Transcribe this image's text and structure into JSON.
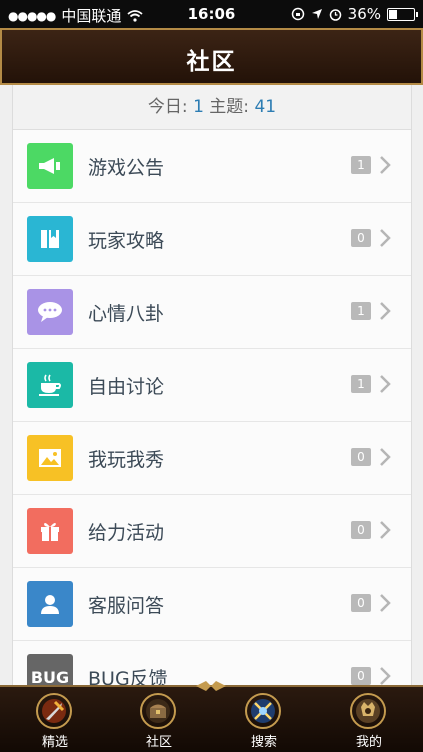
{
  "status_bar": {
    "carrier": "中国联通",
    "time": "16:06",
    "battery": "36%",
    "battery_level": 0.36
  },
  "header": {
    "title": "社区"
  },
  "stats": {
    "today_label": "今日:",
    "today_value": "1",
    "topics_label": "主题:",
    "topics_value": "41"
  },
  "forums": [
    {
      "label": "游戏公告",
      "count": "1",
      "icon": "megaphone-icon",
      "color": "#4cd964"
    },
    {
      "label": "玩家攻略",
      "count": "0",
      "icon": "book-icon",
      "color": "#2ab6d3"
    },
    {
      "label": "心情八卦",
      "count": "1",
      "icon": "chat-bubble-icon",
      "color": "#a993e6"
    },
    {
      "label": "自由讨论",
      "count": "1",
      "icon": "coffee-cup-icon",
      "color": "#1bb9a6"
    },
    {
      "label": "我玩我秀",
      "count": "0",
      "icon": "picture-icon",
      "color": "#f7c125"
    },
    {
      "label": "给力活动",
      "count": "0",
      "icon": "gift-icon",
      "color": "#f26d5f"
    },
    {
      "label": "客服问答",
      "count": "0",
      "icon": "user-icon",
      "color": "#3a87c9"
    },
    {
      "label": "BUG反馈",
      "count": "0",
      "icon": "bug-icon",
      "color": "#666666",
      "icon_text": "BUG"
    }
  ],
  "tabbar": {
    "tabs": [
      {
        "label": "精选",
        "icon": "sword-icon"
      },
      {
        "label": "社区",
        "icon": "treasure-chest-icon"
      },
      {
        "label": "搜索",
        "icon": "magic-orb-icon"
      },
      {
        "label": "我的",
        "icon": "warrior-avatar-icon"
      }
    ]
  }
}
